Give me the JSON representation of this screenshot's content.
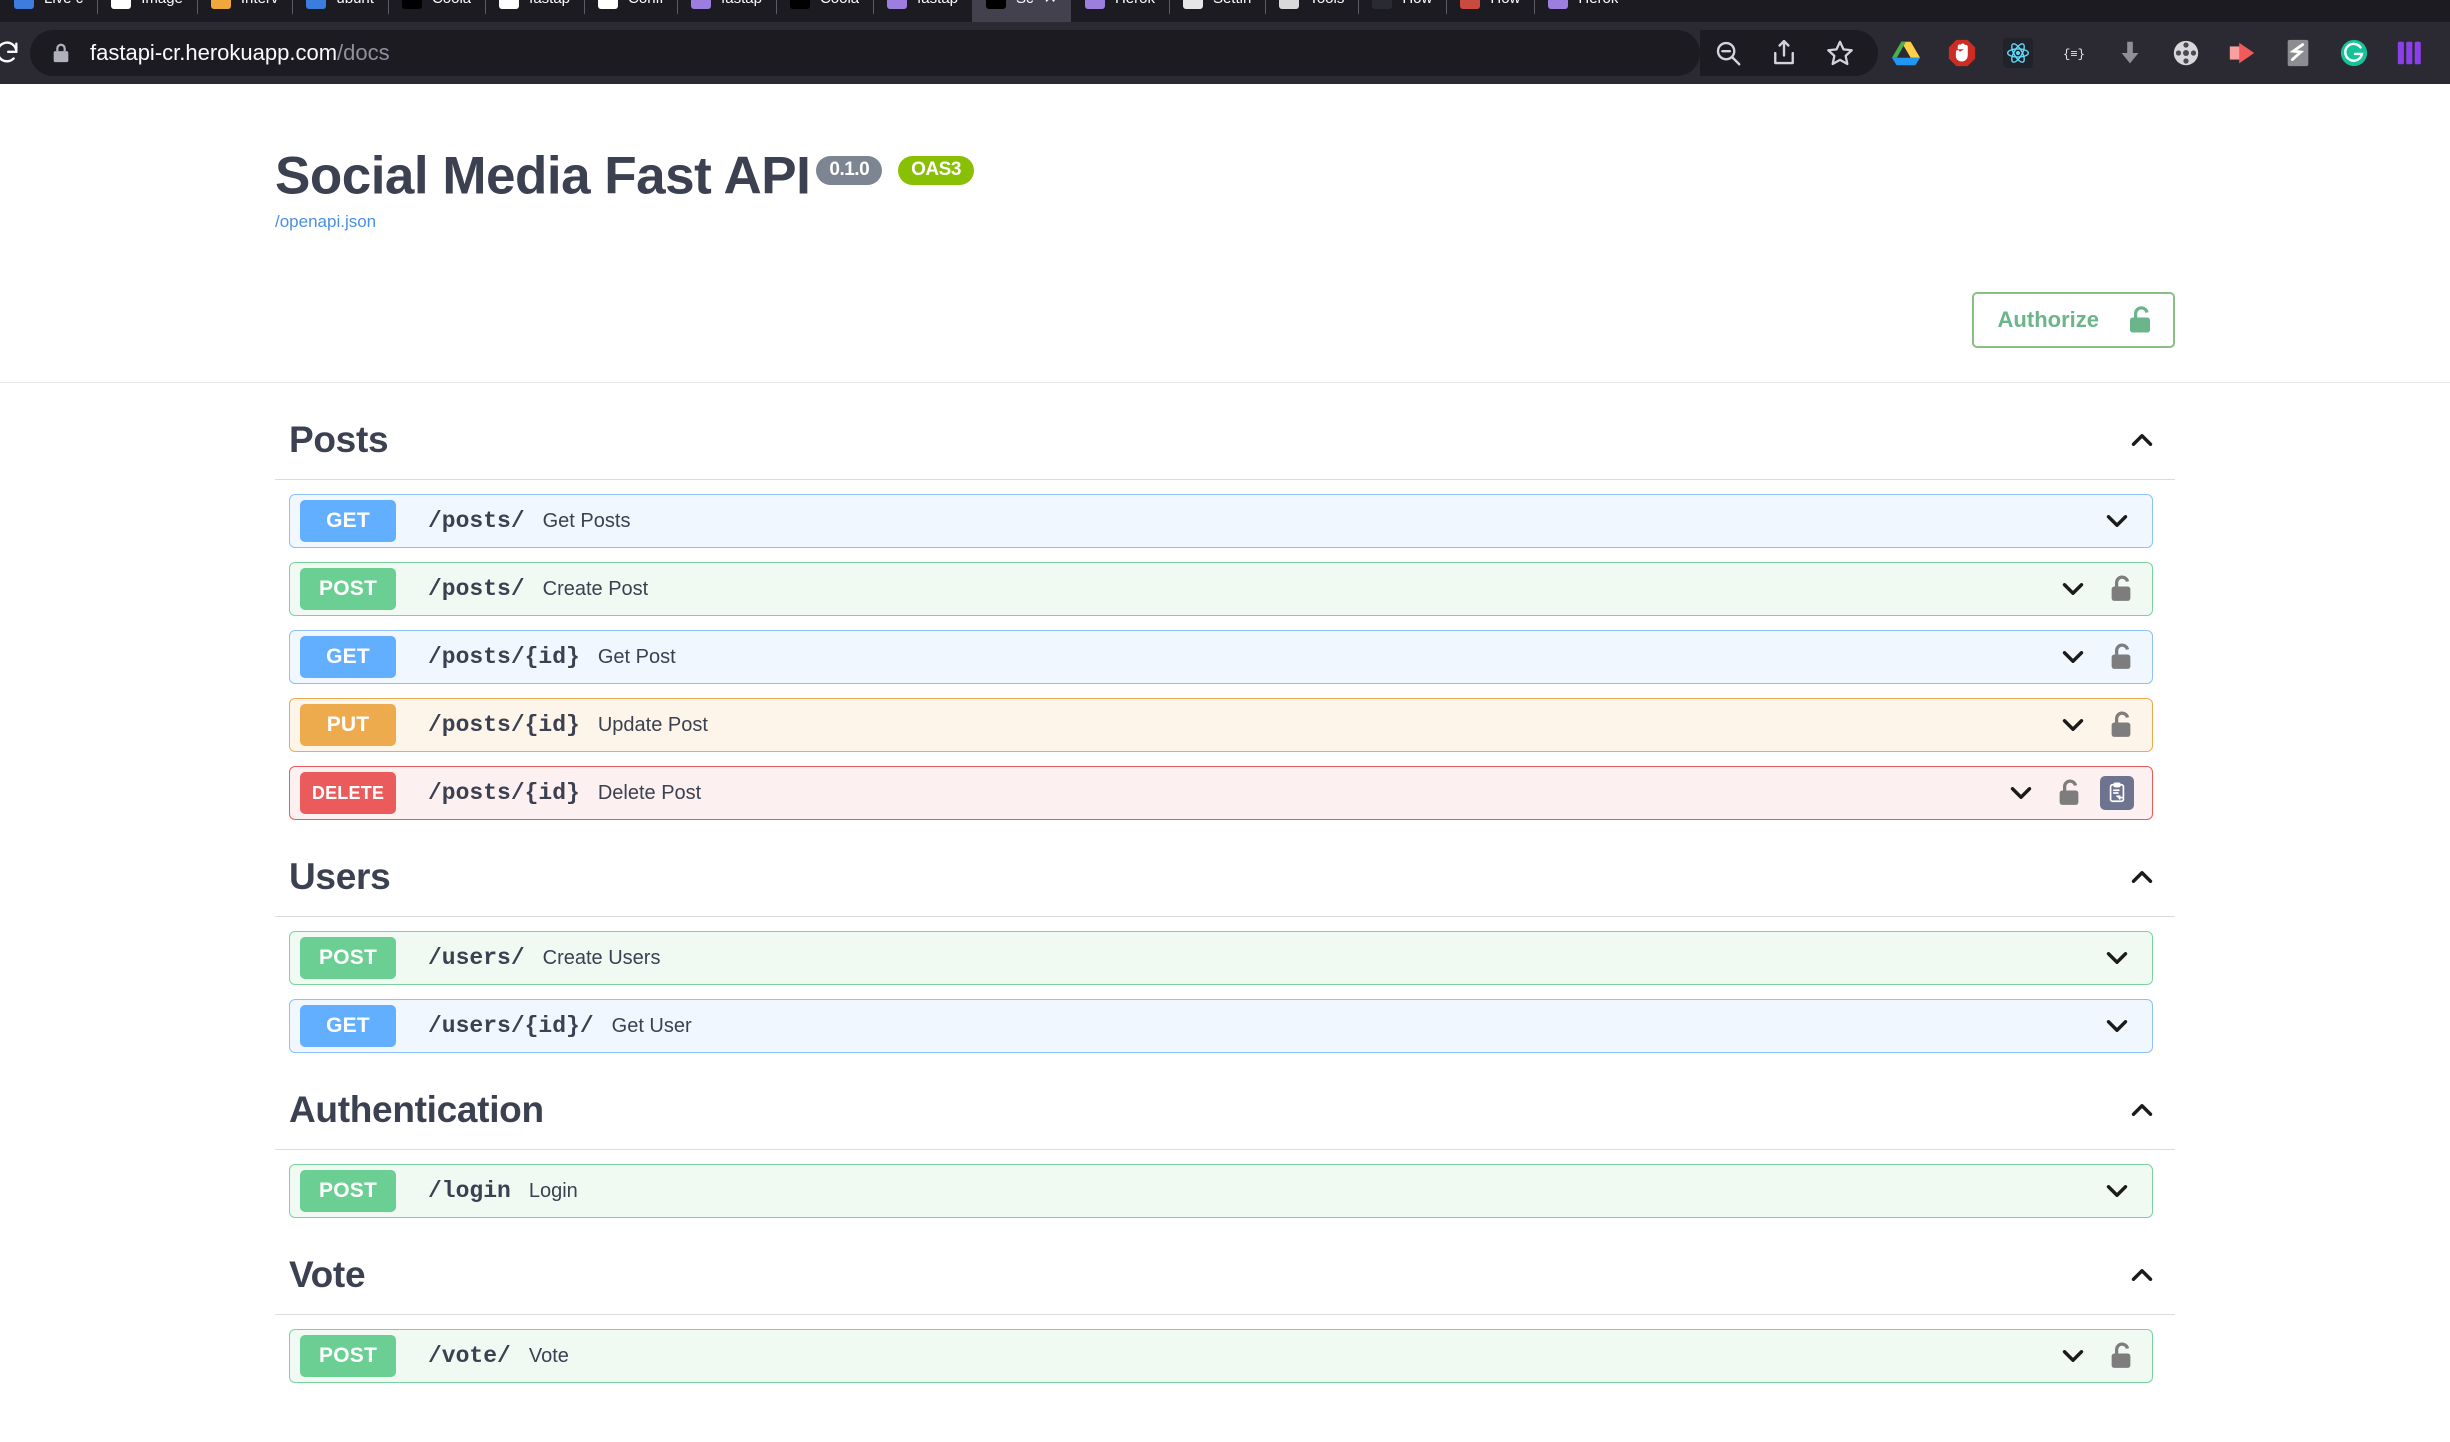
{
  "browser": {
    "tabs": [
      {
        "label": "Live c",
        "favicon": "#3f7ce0",
        "active": false
      },
      {
        "label": "Image",
        "favicon": "#ffffff",
        "active": false
      },
      {
        "label": "Interv",
        "favicon": "#f0a83c",
        "active": false
      },
      {
        "label": "ubunt",
        "favicon": "#3b7ddd",
        "active": false
      },
      {
        "label": "Coola",
        "favicon": "#000000",
        "active": false
      },
      {
        "label": "fastap",
        "favicon": "#ffffff",
        "active": false
      },
      {
        "label": "Confi",
        "favicon": "#ffffff",
        "active": false
      },
      {
        "label": "fastap",
        "favicon": "#9b7ede",
        "active": false
      },
      {
        "label": "Coola",
        "favicon": "#000000",
        "active": false
      },
      {
        "label": "fastap",
        "favicon": "#9b7ede",
        "active": false
      },
      {
        "label": "Sc",
        "favicon": "#000000",
        "active": true
      },
      {
        "label": "Herok",
        "favicon": "#9b7ede",
        "active": false
      },
      {
        "label": "Settin",
        "favicon": "#e6e6e6",
        "active": false
      },
      {
        "label": "Tools",
        "favicon": "#d9d9d9",
        "active": false
      },
      {
        "label": "How",
        "favicon": "#2a2a33",
        "active": false
      },
      {
        "label": "How",
        "favicon": "#c94b3f",
        "active": false
      },
      {
        "label": "Herok",
        "favicon": "#9b7ede",
        "active": false
      }
    ],
    "close_glyph": "✕",
    "url_secure": "fastapi-cr.herokuapp.com",
    "url_path": "/docs",
    "reload_icon": "reload-icon",
    "lock_icon": "padlock-icon",
    "toolbar_icons": [
      {
        "name": "zoom-out-icon",
        "color": "#cfcfd8"
      },
      {
        "name": "share-icon",
        "color": "#cfcfd8"
      },
      {
        "name": "bookmark-star-icon",
        "color": "#cfcfd8"
      },
      {
        "name": "google-drive-extension-icon",
        "color": "#4285f4"
      },
      {
        "name": "ublock-origin-extension-icon",
        "color": "#cc2c24"
      },
      {
        "name": "react-devtools-extension-icon",
        "color": "#20232a"
      },
      {
        "name": "json-formatter-extension-icon",
        "color": "#2b2a33"
      },
      {
        "name": "download-manager-extension-icon",
        "color": "#8a8a94"
      },
      {
        "name": "film-reel-extension-icon",
        "color": "#d8d8dc"
      },
      {
        "name": "video-speed-extension-icon",
        "color": "#f05a5a"
      },
      {
        "name": "stylus-extension-icon",
        "color": "#8c8c93"
      },
      {
        "name": "grammarly-extension-icon",
        "color": "#15c39a"
      },
      {
        "name": "tab-manager-extension-icon",
        "color": "#8b3fe8"
      }
    ]
  },
  "api": {
    "title": "Social Media Fast API",
    "version_badge": "0.1.0",
    "spec_badge": "OAS3",
    "spec_link": "/openapi.json",
    "authorize_label": "Authorize",
    "authorize_icon": "unlocked-padlock-icon",
    "authorize_color": "#6bb58a"
  },
  "sections": [
    {
      "name": "Posts",
      "expanded": true,
      "collapse_icon": "chevron-up-icon",
      "operations": [
        {
          "method": "GET",
          "path": "/posts/",
          "summary": "Get Posts",
          "locked": false,
          "copy": false
        },
        {
          "method": "POST",
          "path": "/posts/",
          "summary": "Create Post",
          "locked": true,
          "copy": false
        },
        {
          "method": "GET",
          "path": "/posts/{id}",
          "summary": "Get Post",
          "locked": true,
          "copy": false
        },
        {
          "method": "PUT",
          "path": "/posts/{id}",
          "summary": "Update Post",
          "locked": true,
          "copy": false
        },
        {
          "method": "DELETE",
          "path": "/posts/{id}",
          "summary": "Delete Post",
          "locked": true,
          "copy": true
        }
      ]
    },
    {
      "name": "Users",
      "expanded": true,
      "collapse_icon": "chevron-up-icon",
      "operations": [
        {
          "method": "POST",
          "path": "/users/",
          "summary": "Create Users",
          "locked": false,
          "copy": false
        },
        {
          "method": "GET",
          "path": "/users/{id}/",
          "summary": "Get User",
          "locked": false,
          "copy": false
        }
      ]
    },
    {
      "name": "Authentication",
      "expanded": true,
      "collapse_icon": "chevron-up-icon",
      "operations": [
        {
          "method": "POST",
          "path": "/login",
          "summary": "Login",
          "locked": false,
          "copy": false
        }
      ]
    },
    {
      "name": "Vote",
      "expanded": true,
      "collapse_icon": "chevron-up-icon",
      "operations": [
        {
          "method": "POST",
          "path": "/vote/",
          "summary": "Vote",
          "locked": true,
          "copy": false
        }
      ]
    }
  ],
  "colors": {
    "get": "#61affe",
    "post": "#6bcf93",
    "put": "#eeab4d",
    "delete": "#ec5b5b",
    "oas_badge": "#89bf04",
    "version_badge": "#7d8492",
    "heading": "#3b4151",
    "link": "#4a90e2"
  }
}
